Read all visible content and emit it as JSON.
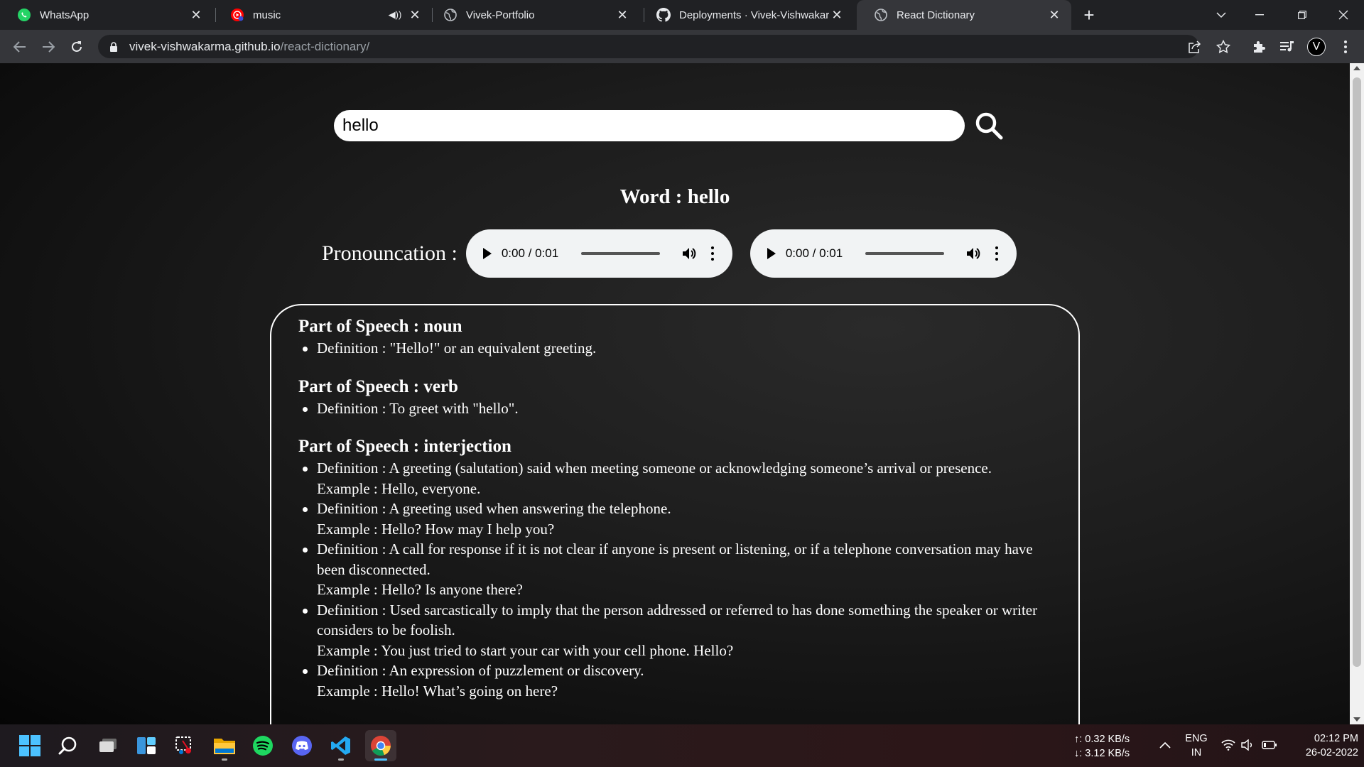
{
  "browser": {
    "tabs": [
      {
        "title": "WhatsApp",
        "icon": "whatsapp-icon",
        "active": false
      },
      {
        "title": "music",
        "icon": "youtube-music-icon",
        "active": false,
        "audio": true
      },
      {
        "title": "Vivek-Portfolio",
        "icon": "globe-icon",
        "active": false
      },
      {
        "title": "Deployments · Vivek-Vishwakarm",
        "icon": "github-icon",
        "active": false
      },
      {
        "title": "React Dictionary",
        "icon": "globe-icon",
        "active": true
      }
    ],
    "url_host": "vivek-vishwakarma.github.io",
    "url_path": "/react-dictionary/",
    "profile_initial": "V"
  },
  "search": {
    "value": "hello"
  },
  "word": {
    "heading": "Word : hello"
  },
  "pronunciation": {
    "label": "Pronouncation :",
    "players": [
      {
        "time": "0:00 / 0:01"
      },
      {
        "time": "0:00 / 0:01"
      }
    ]
  },
  "meanings": [
    {
      "pos_heading": "Part of Speech : noun",
      "items": [
        {
          "definition": "Definition : \"Hello!\" or an equivalent greeting."
        }
      ]
    },
    {
      "pos_heading": "Part of Speech : verb",
      "items": [
        {
          "definition": "Definition : To greet with \"hello\"."
        }
      ]
    },
    {
      "pos_heading": "Part of Speech : interjection",
      "items": [
        {
          "definition": "Definition : A greeting (salutation) said when meeting someone or acknowledging someone’s arrival or presence.",
          "example": "Example : Hello, everyone."
        },
        {
          "definition": "Definition : A greeting used when answering the telephone.",
          "example": "Example : Hello? How may I help you?"
        },
        {
          "definition": "Definition : A call for response if it is not clear if anyone is present or listening, or if a telephone conversation may have been disconnected.",
          "example": "Example : Hello? Is anyone there?"
        },
        {
          "definition": "Definition : Used sarcastically to imply that the person addressed or referred to has done something the speaker or writer considers to be foolish.",
          "example": "Example : You just tried to start your car with your cell phone. Hello?"
        },
        {
          "definition": "Definition : An expression of puzzlement or discovery.",
          "example": "Example : Hello! What’s going on here?"
        }
      ]
    }
  ],
  "taskbar": {
    "apps": [
      "windows-start-icon",
      "search-icon",
      "task-view-icon",
      "widgets-icon",
      "snipping-tool-icon",
      "file-explorer-icon",
      "spotify-icon",
      "discord-icon",
      "vscode-icon",
      "chrome-icon"
    ],
    "net_up": "↑: 0.32 KB/s",
    "net_down": "↓: 3.12 KB/s",
    "lang_top": "ENG",
    "lang_bottom": "IN",
    "time": "02:12 PM",
    "date": "26-02-2022"
  }
}
